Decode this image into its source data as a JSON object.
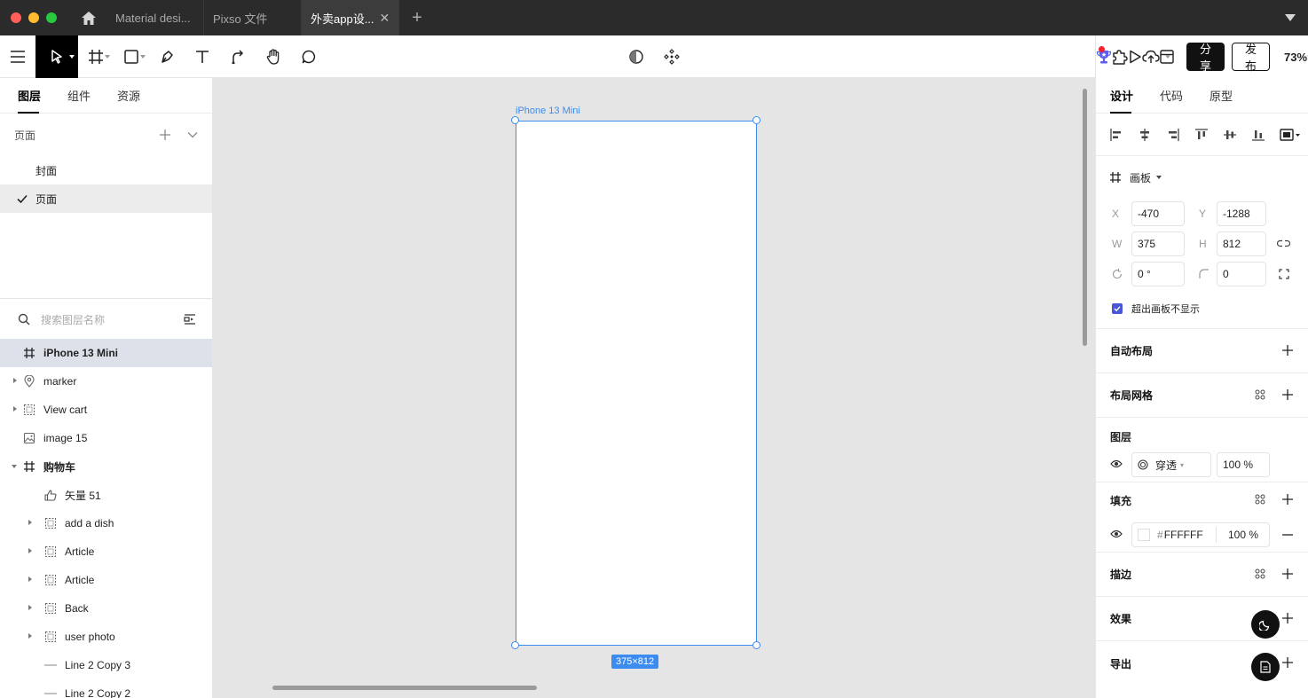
{
  "tabs": [
    {
      "label": "Material desi..."
    },
    {
      "label": "Pixso 文件"
    },
    {
      "label": "外卖app设..."
    }
  ],
  "toolbar": {
    "share_label": "分享",
    "publish_label": "发布",
    "zoom": "73%"
  },
  "left_panel": {
    "tabs": [
      "图层",
      "组件",
      "资源"
    ],
    "pages_title": "页面",
    "pages": [
      "封面",
      "页面"
    ],
    "search_placeholder": "搜索图层名称",
    "layers": [
      {
        "name": "iPhone 13 Mini",
        "icon": "frame-icon"
      },
      {
        "name": "marker",
        "icon": "location-pin-icon"
      },
      {
        "name": "View cart",
        "icon": "component-icon"
      },
      {
        "name": "image 15",
        "icon": "image-icon"
      },
      {
        "name": "购物车",
        "icon": "frame-icon"
      },
      {
        "name": "矢量 51",
        "icon": "thumbs-up-icon"
      },
      {
        "name": "add a dish",
        "icon": "component-icon"
      },
      {
        "name": "Article",
        "icon": "component-icon"
      },
      {
        "name": "Article",
        "icon": "component-icon"
      },
      {
        "name": "Back",
        "icon": "component-icon"
      },
      {
        "name": "user photo",
        "icon": "component-icon"
      },
      {
        "name": "Line 2 Copy 3",
        "icon": "line-icon"
      },
      {
        "name": "Line 2 Copy 2",
        "icon": "line-icon"
      }
    ]
  },
  "canvas": {
    "frame_name": "iPhone 13 Mini",
    "size_tag": "375×812"
  },
  "right_panel": {
    "tabs": [
      "设计",
      "代码",
      "原型"
    ],
    "frame_type": "画板",
    "x_label": "X",
    "x": "-470",
    "y_label": "Y",
    "y": "-1288",
    "w_label": "W",
    "w": "375",
    "h_label": "H",
    "h": "812",
    "rotation": "0 °",
    "radius": "0",
    "clip_label": "超出画板不显示",
    "auto_layout": "自动布局",
    "layout_grid": "布局网格",
    "layer_title": "图层",
    "blend_mode": "穿透",
    "layer_opacity": "100 %",
    "fill_title": "填充",
    "fill_hash": "#",
    "fill_hex": "FFFFFF",
    "fill_opacity": "100 %",
    "stroke_title": "描边",
    "effects_title": "效果",
    "export_title": "导出"
  },
  "colors": {
    "accent": "#3c8bf0",
    "checkbox": "#4a56d8",
    "canvas_bg": "#e5e5e5"
  }
}
